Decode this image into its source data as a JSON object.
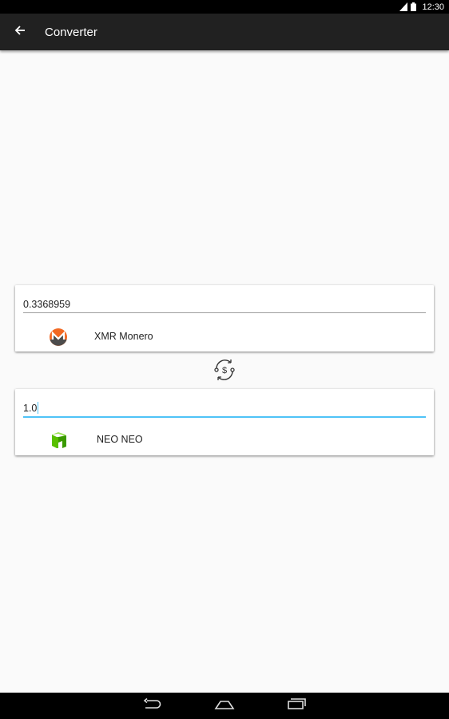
{
  "status_bar": {
    "time": "12:30",
    "icons": [
      "signal-icon",
      "battery-icon"
    ]
  },
  "app_bar": {
    "title": "Converter",
    "back_icon": "arrow-back-icon"
  },
  "converter": {
    "from": {
      "amount": "0.3368959",
      "icon": "monero-icon",
      "label": "XMR Monero",
      "brand_color": "#f26822"
    },
    "to": {
      "amount": "1.0",
      "icon": "neo-icon",
      "label": "NEO NEO",
      "brand_color": "#58bf00"
    },
    "swap_icon": "currency-swap-icon"
  },
  "colors": {
    "app_bar": "#212121",
    "focus_accent": "#4fc3f7",
    "background": "#fafafa"
  },
  "nav_bar": {
    "icons": [
      "back-nav-icon",
      "home-nav-icon",
      "recents-nav-icon"
    ]
  }
}
